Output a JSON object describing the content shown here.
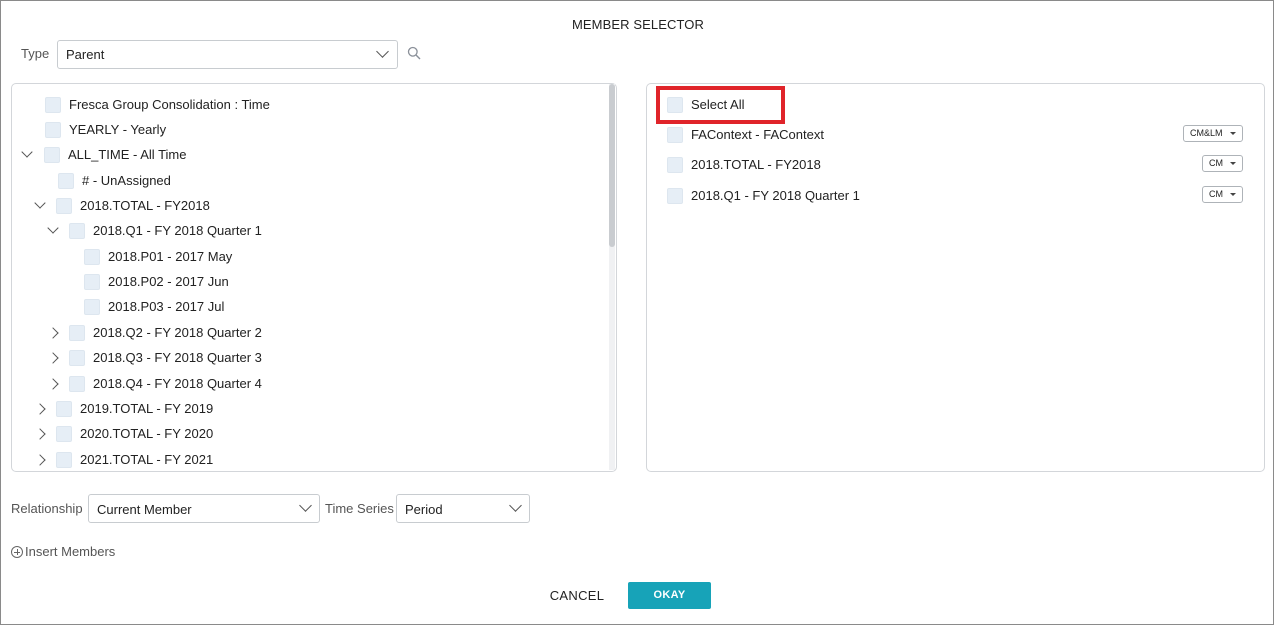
{
  "dialog": {
    "title": "MEMBER SELECTOR"
  },
  "type": {
    "label": "Type",
    "value": "Parent"
  },
  "tree": [
    {
      "label": "Fresca Group Consolidation : Time",
      "expander": "none"
    },
    {
      "label": "YEARLY - Yearly",
      "expander": "none"
    },
    {
      "label": "ALL_TIME - All Time",
      "expander": "expanded"
    },
    {
      "label": "# - UnAssigned",
      "expander": "none"
    },
    {
      "label": "2018.TOTAL - FY2018",
      "expander": "expanded"
    },
    {
      "label": "2018.Q1 - FY 2018 Quarter 1",
      "expander": "expanded"
    },
    {
      "label": "2018.P01 - 2017 May",
      "expander": "none"
    },
    {
      "label": "2018.P02 - 2017 Jun",
      "expander": "none"
    },
    {
      "label": "2018.P03 - 2017 Jul",
      "expander": "none"
    },
    {
      "label": "2018.Q2 - FY 2018 Quarter 2",
      "expander": "collapsed"
    },
    {
      "label": "2018.Q3 - FY 2018 Quarter 3",
      "expander": "collapsed"
    },
    {
      "label": "2018.Q4 - FY 2018 Quarter 4",
      "expander": "collapsed"
    },
    {
      "label": "2019.TOTAL - FY 2019",
      "expander": "collapsed"
    },
    {
      "label": "2020.TOTAL - FY 2020",
      "expander": "collapsed"
    },
    {
      "label": "2021.TOTAL - FY 2021",
      "expander": "collapsed"
    }
  ],
  "selected": {
    "select_all_label": "Select All",
    "items": [
      {
        "label": "FAContext - FAContext",
        "context": "CM&LM"
      },
      {
        "label": "2018.TOTAL - FY2018",
        "context": "CM"
      },
      {
        "label": "2018.Q1 - FY 2018 Quarter 1",
        "context": "CM"
      }
    ]
  },
  "relationship": {
    "label": "Relationship",
    "value": "Current Member"
  },
  "time_series": {
    "label": "Time Series",
    "value": "Period"
  },
  "insert_members": {
    "label": "Insert Members"
  },
  "buttons": {
    "cancel": "CANCEL",
    "okay": "OKAY"
  },
  "colors": {
    "accent": "#17a3b8",
    "highlight": "#e0242a",
    "checkbox": "#e6eef6"
  },
  "icons": {
    "search": "search-icon",
    "expand": "chevron-icon",
    "insert": "plus-circle-icon"
  }
}
